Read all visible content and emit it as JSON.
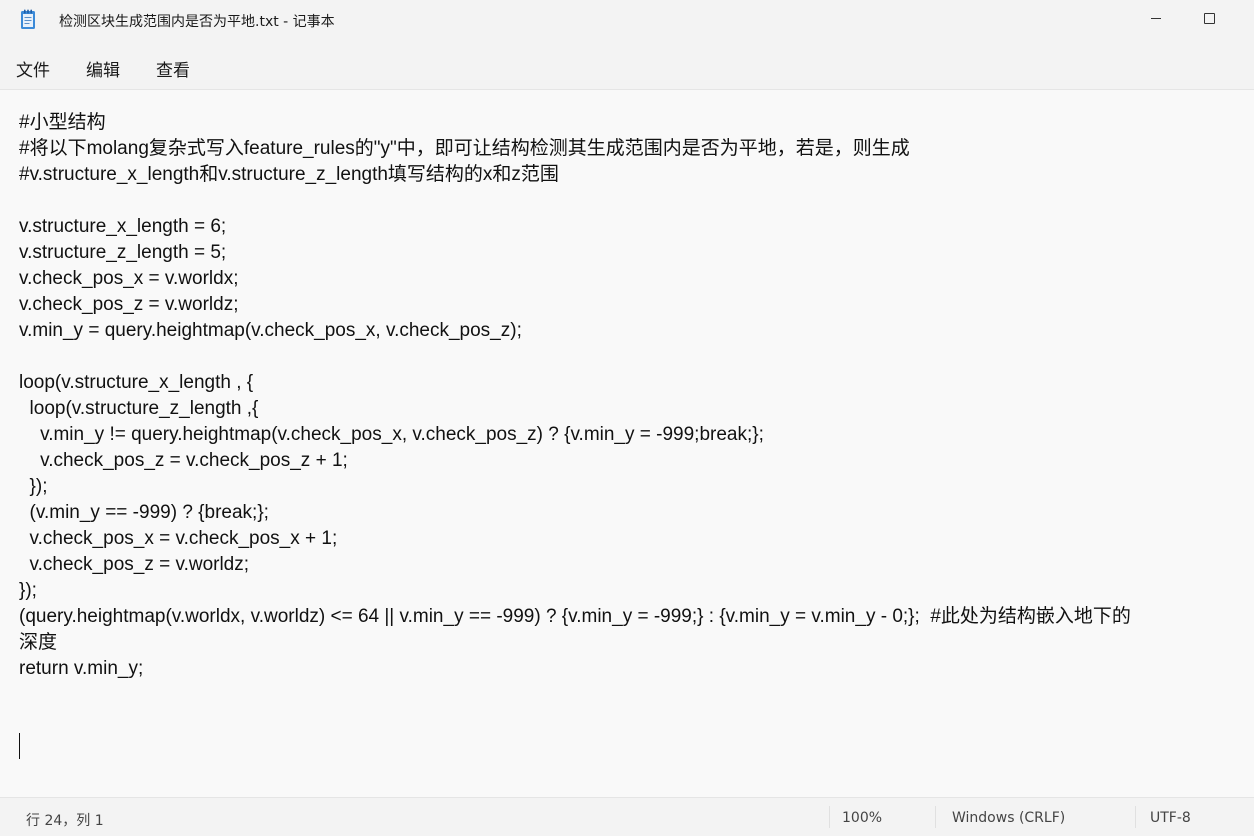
{
  "window": {
    "title": "检测区块生成范围内是否为平地.txt - 记事本",
    "icon": "notepad-icon"
  },
  "menu": {
    "file": "文件",
    "edit": "编辑",
    "view": "查看"
  },
  "editor": {
    "lines": [
      "#小型结构",
      "#将以下molang复杂式写入feature_rules的\"y\"中，即可让结构检测其生成范围内是否为平地，若是，则生成",
      "#v.structure_x_length和v.structure_z_length填写结构的x和z范围",
      "",
      "v.structure_x_length = 6;",
      "v.structure_z_length = 5;",
      "v.check_pos_x = v.worldx;",
      "v.check_pos_z = v.worldz;",
      "v.min_y = query.heightmap(v.check_pos_x, v.check_pos_z);",
      "",
      "loop(v.structure_x_length , {",
      "  loop(v.structure_z_length ,{",
      "    v.min_y != query.heightmap(v.check_pos_x, v.check_pos_z) ? {v.min_y = -999;break;};",
      "    v.check_pos_z = v.check_pos_z + 1;",
      "  });",
      "  (v.min_y == -999) ? {break;};",
      "  v.check_pos_x = v.check_pos_x + 1;",
      "  v.check_pos_z = v.worldz;",
      "});",
      "(query.heightmap(v.worldx, v.worldz) <= 64 || v.min_y == -999) ? {v.min_y = -999;} : {v.min_y = v.min_y - 0;};  #此处为结构嵌入地下的",
      "深度",
      "return v.min_y;",
      "",
      ""
    ]
  },
  "status": {
    "position": "行 24，列 1",
    "zoom": "100%",
    "line_ending": "Windows (CRLF)",
    "encoding": "UTF-8"
  }
}
